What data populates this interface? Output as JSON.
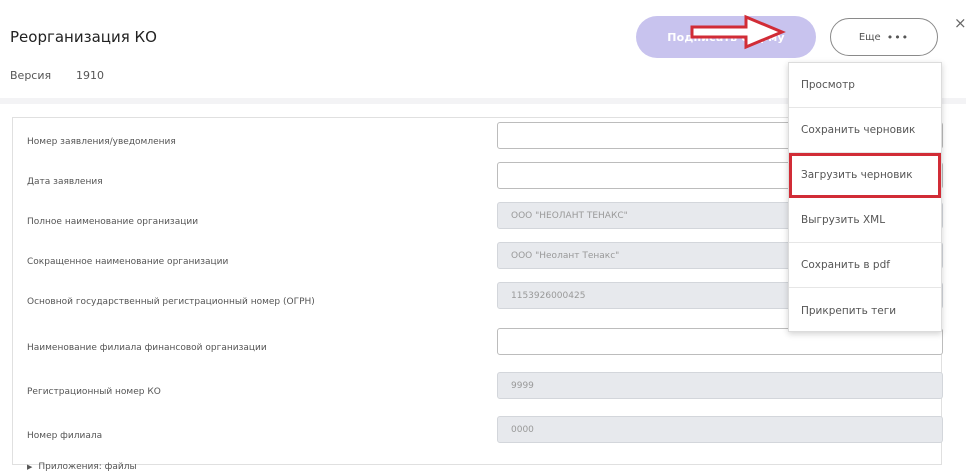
{
  "header": {
    "title": "Реорганизация КО",
    "version_label": "Версия",
    "version_value": "1910",
    "submit_label": "Подписать форму",
    "more_label": "Еще",
    "more_dots": "•••",
    "close_glyph": "×"
  },
  "form": {
    "rows": [
      {
        "label": "Номер заявления/уведомления",
        "value": ""
      },
      {
        "label": "Дата заявления",
        "value": ""
      },
      {
        "label": "Полное наименование организации",
        "value": "ООО \"НЕОЛАНТ ТЕНАКС\""
      },
      {
        "label": "Сокращенное наименование организации",
        "value": "ООО \"Неолант Тенакс\""
      },
      {
        "label": "Основной государственный регистрационный номер (ОГРН)",
        "value": "1153926000425"
      },
      {
        "label": "Наименование филиала финансовой организации",
        "value": ""
      },
      {
        "label": "Регистрационный номер КО",
        "value": "9999"
      },
      {
        "label": "Номер филиала",
        "value": "0000"
      }
    ],
    "attachments_label": "Приложения: файлы"
  },
  "menu": {
    "items": [
      {
        "label": "Просмотр"
      },
      {
        "label": "Сохранить черновик"
      },
      {
        "label": "Загрузить черновик"
      },
      {
        "label": "Выгрузить XML"
      },
      {
        "label": "Сохранить в pdf"
      },
      {
        "label": "Прикрепить теги"
      }
    ]
  },
  "colors": {
    "accent_button": "#c8c3ee",
    "highlight_red": "#d12c36",
    "readonly_bg": "#e7e9ed"
  }
}
